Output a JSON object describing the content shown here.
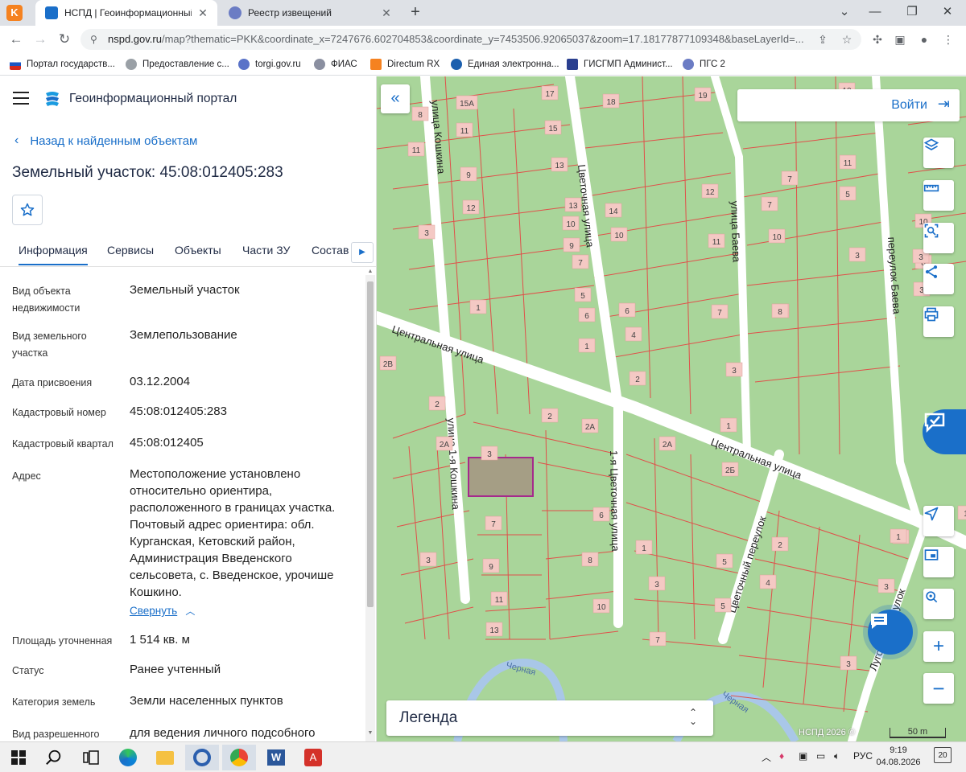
{
  "browser": {
    "tabs": [
      {
        "title": "НСПД | Геоинформационный п",
        "active": true
      },
      {
        "title": "Реестр извещений",
        "active": false
      }
    ],
    "url_host": "nspd.gov.ru",
    "url_rest": "/map?thematic=PKK&coordinate_x=7247676.602704853&coordinate_y=7453506.92065037&zoom=17.18177877109348&baseLayerId=...",
    "bookmarks": [
      "Портал государств...",
      "Предоставление с...",
      "torgi.gov.ru",
      "ФИАС",
      "Directum RX",
      "Единая электронна...",
      "ГИСГМП Админист...",
      "ПГС 2"
    ]
  },
  "header": {
    "portal_title": "Геоинформационный портал"
  },
  "nav": {
    "back_label": "Назад к найденным объектам"
  },
  "object": {
    "title": "Земельный участок: 45:08:012405:283"
  },
  "tabs": [
    "Информация",
    "Сервисы",
    "Объекты",
    "Части ЗУ",
    "Состав"
  ],
  "properties": [
    {
      "label": "Вид объекта недвижимости",
      "value": "Земельный участок"
    },
    {
      "label": "Вид земельного участка",
      "value": "Землепользование"
    },
    {
      "label": "Дата присвоения",
      "value": "03.12.2004"
    },
    {
      "label": "Кадастровый номер",
      "value": "45:08:012405:283"
    },
    {
      "label": "Кадастровый квартал",
      "value": "45:08:012405"
    },
    {
      "label": "Адрес",
      "value": "Местоположение установлено относительно ориентира, расположенного в границах участка. Почтовый адрес ориентира: обл. Курганская, Кетовский район, Администрация Введенского сельсовета, с. Введенское, урочише Кошкино."
    },
    {
      "label": "Площадь уточненная",
      "value": "1 514 кв. м"
    },
    {
      "label": "Статус",
      "value": "Ранее учтенный"
    },
    {
      "label": "Категория земель",
      "value": "Земли населенных пунктов"
    },
    {
      "label": "Вид разрешенного",
      "value": "для ведения личного подсобного"
    }
  ],
  "collapse_label": "Свернуть",
  "map": {
    "login_label": "Войти",
    "legend_label": "Легенда",
    "copyright": "НСПД 2026 ©",
    "scale_label": "50 m",
    "streets": [
      "улица Кошкина",
      "Цветочная улица",
      "улица Баева",
      "переулок Баева",
      "Центральная улица",
      "улица 1-я Кошкина",
      "1-я Цветочная улица",
      "Цветочный переулок",
      "Луговой переулок",
      "Черная"
    ],
    "parcel_numbers": [
      "8",
      "15А",
      "17",
      "18",
      "19",
      "11",
      "11",
      "15",
      "10",
      "9",
      "13",
      "7",
      "11",
      "12",
      "13",
      "14",
      "12",
      "7",
      "5",
      "10",
      "3",
      "9",
      "10",
      "11",
      "10",
      "3",
      "7",
      "8",
      "10",
      "1",
      "5",
      "6",
      "7",
      "8",
      "6",
      "3",
      "4",
      "1",
      "2",
      "3",
      "2В",
      "2",
      "1",
      "2А",
      "2",
      "2А",
      "3",
      "2А",
      "2Б",
      "6",
      "8",
      "10",
      "3",
      "7",
      "9",
      "11",
      "13",
      "1",
      "3",
      "5",
      "2",
      "4",
      "5",
      "3",
      "1",
      "1",
      "3",
      "7",
      "1",
      "3",
      "8"
    ]
  },
  "taskbar": {
    "language": "РУС",
    "time": "9:19",
    "date": "04.08.2026",
    "notifications": "20"
  },
  "colors": {
    "accent": "#1a6fc9",
    "map_green": "#a9d59a",
    "parcel_line": "#e0504a",
    "selected_parcel": "#a59e85"
  }
}
